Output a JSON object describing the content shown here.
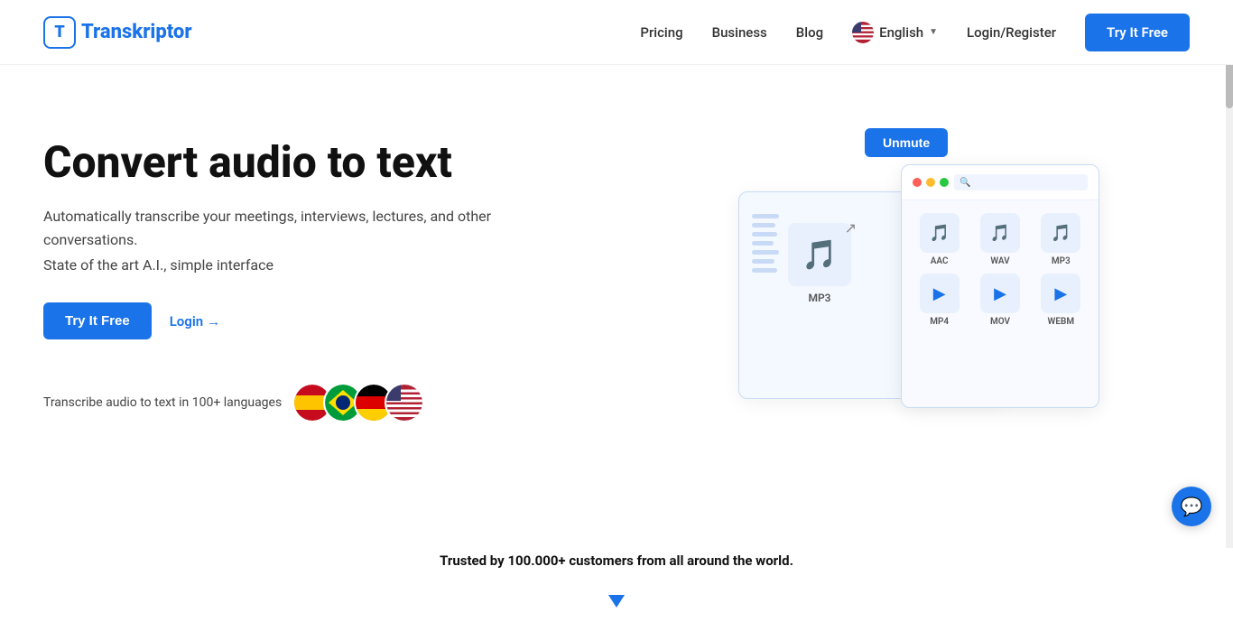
{
  "brand": {
    "logo_letter": "T",
    "name": "ranskriptor"
  },
  "nav": {
    "links": [
      {
        "label": "Pricing",
        "id": "pricing"
      },
      {
        "label": "Business",
        "id": "business"
      },
      {
        "label": "Blog",
        "id": "blog"
      }
    ],
    "language": "English",
    "login_register": "Login/Register",
    "cta": "Try It Free"
  },
  "hero": {
    "title": "Convert audio to text",
    "description": "Automatically transcribe your meetings, interviews, lectures, and other conversations.",
    "subtitle": "State of the art A.I., simple interface",
    "cta_primary": "Try It Free",
    "cta_secondary": "Login",
    "cta_arrow": "→",
    "languages_text": "Transcribe audio to text in 100+ languages",
    "flags": [
      "🇪🇸",
      "🇧🇷",
      "🇩🇪",
      "🇺🇸"
    ]
  },
  "preview": {
    "unmute_btn": "Unmute",
    "file_label": "MP3",
    "search_placeholder": "🔍",
    "formats_audio": [
      "AAC",
      "WAV",
      "MP3"
    ],
    "formats_video": [
      "MP4",
      "MOV",
      "WEBM"
    ]
  },
  "trusted": {
    "text": "Trusted by 100.000+ customers from all around the world."
  },
  "chat": {
    "icon": "💬"
  },
  "colors": {
    "primary": "#1a73e8",
    "text_dark": "#111",
    "text_mid": "#444",
    "bg": "#fff"
  }
}
